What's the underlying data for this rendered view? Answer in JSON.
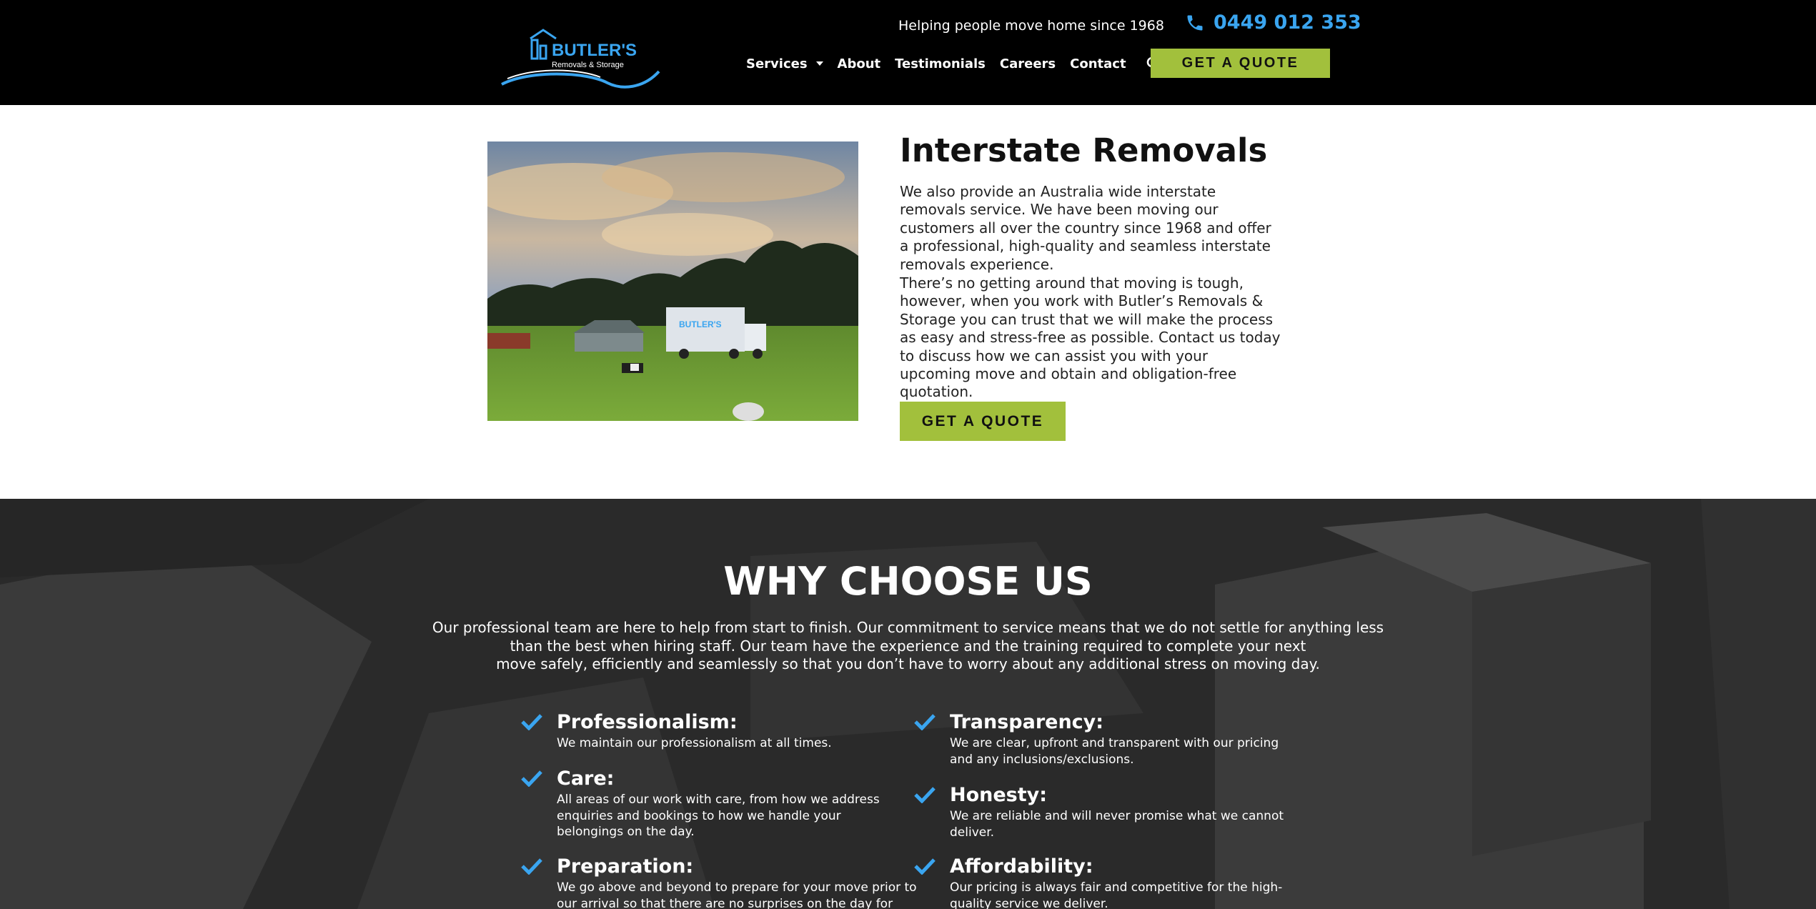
{
  "header": {
    "logo_text": "BUTLER'S",
    "logo_subtext": "Removals & Storage",
    "tagline": "Helping people move home since 1968",
    "phone": "0449 012 353",
    "nav": [
      {
        "label": "Services"
      },
      {
        "label": "About"
      },
      {
        "label": "Testimonials"
      },
      {
        "label": "Careers"
      },
      {
        "label": "Contact"
      }
    ],
    "quote_button": "GET A QUOTE"
  },
  "interstate": {
    "title": "Interstate Removals",
    "paragraph1": "We also provide an Australia wide interstate removals service. We have been moving our customers all over the country since 1968 and offer a professional, high-quality and seamless interstate removals experience.",
    "paragraph2": "There’s no getting around that moving is tough, however, when you work with Butler’s Removals & Storage you can trust that we will make the process as easy and stress-free as possible. Contact us today to discuss how we can assist you with your upcoming move and obtain and obligation-free quotation.",
    "quote_button": "GET A QUOTE"
  },
  "why": {
    "title": "WHY CHOOSE US",
    "intro_lines": [
      "Our professional team are here to help from start to finish. Our commitment to service means that we do not settle for anything less than the best when hiring staff. Our team have the experience and the training required to complete your next",
      "move safely, efficiently and seamlessly so that you don’t have to worry about any additional stress on moving day."
    ],
    "features": [
      {
        "title": "Professionalism:",
        "text": "We maintain our professionalism at all times."
      },
      {
        "title": "Care:",
        "text": "All areas of our work with care, from how we address enquiries and bookings to how we handle your belongings on the day."
      },
      {
        "title": "Preparation:",
        "text": "We go above and beyond to prepare for your move prior to our arrival so that there are no surprises on the day for you."
      },
      {
        "title": "Transparency:",
        "text": "We are clear, upfront and transparent with our pricing and any inclusions/exclusions."
      },
      {
        "title": "Honesty:",
        "text": "We are reliable and will never promise what we cannot deliver."
      },
      {
        "title": "Affordability:",
        "text": "Our pricing is always fair and competitive for the high-quality service we deliver."
      }
    ]
  },
  "colors": {
    "accent_green": "#a2c03c",
    "accent_blue": "#3aa5f0",
    "header_bg": "#000000",
    "why_bg": "#2b2b2b"
  }
}
